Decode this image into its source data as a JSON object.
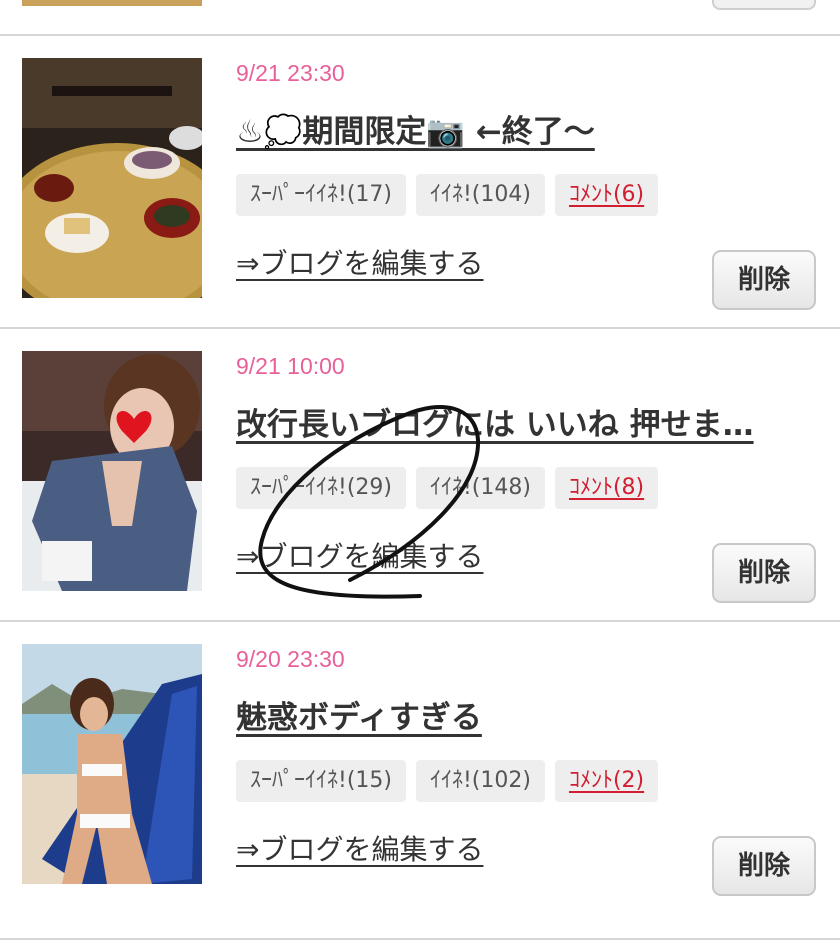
{
  "entries": [
    {
      "date": "9/21 23:30",
      "title": "♨💭期間限定📷 ←終了〜",
      "super_like": "ｽｰﾊﾟｰｲｲﾈ!(17)",
      "like": "ｲｲﾈ!(104)",
      "comment": "ｺﾒﾝﾄ(6)",
      "edit_label": "⇒ブログを編集する",
      "delete_label": "削除"
    },
    {
      "date": "9/21 10:00",
      "title": "改行長いブログには いいね 押せま…",
      "super_like": "ｽｰﾊﾟｰｲｲﾈ!(29)",
      "like": "ｲｲﾈ!(148)",
      "comment": "ｺﾒﾝﾄ(8)",
      "edit_label": "⇒ブログを編集する",
      "delete_label": "削除"
    },
    {
      "date": "9/20 23:30",
      "title": "魅惑ボディすぎる",
      "super_like": "ｽｰﾊﾟｰｲｲﾈ!(15)",
      "like": "ｲｲﾈ!(102)",
      "comment": "ｺﾒﾝﾄ(2)",
      "edit_label": "⇒ブログを編集する",
      "delete_label": "削除"
    }
  ],
  "colors": {
    "date": "#e8609a",
    "comment": "#d11e30",
    "badge_bg": "#eeeeee",
    "divider": "#d6d6d6"
  }
}
